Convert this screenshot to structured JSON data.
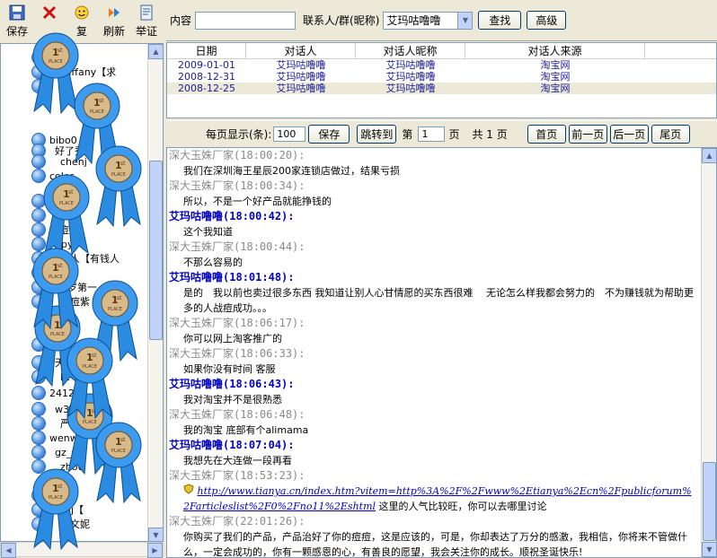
{
  "toolbar": {
    "save": "保存",
    "delete_partial": "复",
    "refresh": "刷新",
    "report": "举证"
  },
  "tree": {
    "items": [
      {
        "text": "g"
      },
      {
        "text": "如tiffany【求"
      },
      {
        "text": "货"
      },
      {
        "text": "bibo0"
      },
      {
        "text": "好了秀"
      },
      {
        "text": "chenj"
      },
      {
        "text": "color"
      },
      {
        "text": "9月"
      },
      {
        "text": "dan"
      },
      {
        "text": "重痘"
      },
      {
        "text": "ppy"
      },
      {
        "text": "生人【有钱人"
      },
      {
        "text": "aini"
      },
      {
        "text": "18岁第一"
      },
      {
        "text": "痘痘紫"
      },
      {
        "text": "】痘"
      },
      {
        "text": "天顶"
      },
      {
        "text": "lit"
      },
      {
        "text": "2412"
      },
      {
        "text": "w3"
      },
      {
        "text": "严重"
      },
      {
        "text": "wenw"
      },
      {
        "text": "gz_sa"
      },
      {
        "text": "zhou"
      },
      {
        "text": "】【客"
      },
      {
        "text": "兜1j【"
      },
      {
        "text": "的文妮"
      }
    ]
  },
  "medal": {
    "line1": "1",
    "line2": "st",
    "line3": "PLACE"
  },
  "search": {
    "content_label": "内容",
    "content_value": "",
    "contact_label": "联系人/群(昵称)",
    "contact_value": "艾玛咕噜噜",
    "find_button": "查找",
    "advanced_button": "高级"
  },
  "grid": {
    "headers": [
      "日期",
      "对话人",
      "对话人昵称",
      "对话人来源"
    ],
    "rows": [
      {
        "date": "2009-01-01",
        "person": "艾玛咕噜噜",
        "nickname": "艾玛咕噜噜",
        "source": "淘宝网"
      },
      {
        "date": "2008-12-31",
        "person": "艾玛咕噜噜",
        "nickname": "艾玛咕噜噜",
        "source": "淘宝网"
      },
      {
        "date": "2008-12-25",
        "person": "艾玛咕噜噜",
        "nickname": "艾玛咕噜噜",
        "source": "淘宝网"
      }
    ]
  },
  "pager": {
    "per_page_label": "每页显示(条):",
    "per_page_value": "100",
    "save_button": "保存",
    "jump_button": "跳转到",
    "page_prefix": "第",
    "page_value": "1",
    "page_suffix": "页",
    "total_text": "共 1 页",
    "first_button": "首页",
    "prev_button": "前一页",
    "next_button": "后一页",
    "last_button": "尾页"
  },
  "chat": {
    "messages": [
      {
        "sender": "深大玉姝厂家",
        "time": "(18:00:20):",
        "type": "other",
        "text": "我们在深圳海王星辰200家连锁店做过，结果亏损"
      },
      {
        "sender": "深大玉姝厂家",
        "time": "(18:00:34):",
        "type": "other",
        "text": "所以，不是一个好产品就能挣钱的"
      },
      {
        "sender": "艾玛咕噜噜",
        "time": "(18:00:42):",
        "type": "me",
        "text": "这个我知道"
      },
      {
        "sender": "深大玉姝厂家",
        "time": "(18:00:44):",
        "type": "other",
        "text": "不那么容易的"
      },
      {
        "sender": "艾玛咕噜噜",
        "time": "(18:01:48):",
        "type": "me",
        "text": "是的　我以前也卖过很多东西 我知道让别人心甘情愿的买东西很难　 无论怎么样我都会努力的　不为赚钱就为帮助更多的人战痘成功。。。"
      },
      {
        "sender": "深大玉姝厂家",
        "time": "(18:06:17):",
        "type": "other",
        "text": "你可以网上淘客推广的"
      },
      {
        "sender": "深大玉姝厂家",
        "time": "(18:06:33):",
        "type": "other",
        "text": "如果你没有时间 客服"
      },
      {
        "sender": "艾玛咕噜噜",
        "time": "(18:06:43):",
        "type": "me",
        "text": "我对淘宝并不是很熟悉"
      },
      {
        "sender": "深大玉姝厂家",
        "time": "(18:06:48):",
        "type": "other",
        "text": "我的淘宝 底部有个alimama"
      },
      {
        "sender": "艾玛咕噜噜",
        "time": "(18:07:04):",
        "type": "me",
        "text": "我想先在大连做一段再看"
      },
      {
        "sender": "深大玉姝厂家",
        "time": "(18:53:23):",
        "type": "other",
        "link": "http://www.tianya.cn/index.htm?vitem=http%3A%2F%2Fwww%2Etianya%2Ecn%2Fpublicforum%2Farticleslist%2F0%2Fno11%2Eshtml",
        "text": "这里的人气比较旺，你可以去哪里讨论"
      },
      {
        "sender": "深大玉姝厂家",
        "time": "(22:01:26):",
        "type": "other",
        "text": "你购买了我们的产品，产品治好了你的痘痘，这是应该的，可是，你却表达了万分的感激，我相信，你将来不管做什么，一定会成功的，你有一颗感恩的心，有善良的愿望，我会关注你的成长。顺祝圣诞快乐!"
      }
    ]
  }
}
